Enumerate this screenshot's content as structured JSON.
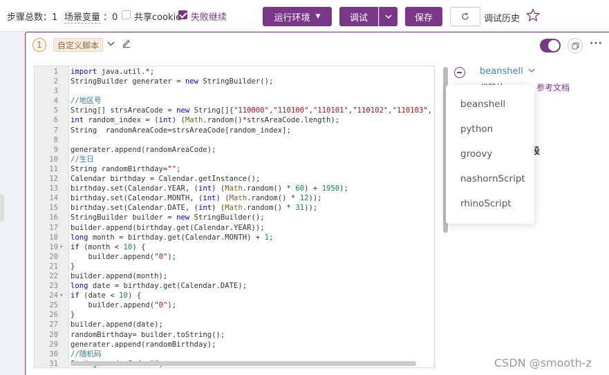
{
  "toolbar": {
    "step_count_label": "步骤总数：1",
    "scene_var_label": "场景变量",
    "scene_var_count": "：0",
    "share_cookie_label": "共享cookie",
    "fail_continue_label": "失败继续",
    "run_env_label": "运行环境",
    "debug_label": "调试",
    "save_label": "保存",
    "debug_history_label": "调试历史"
  },
  "step": {
    "number": "1",
    "tag": "自定义脚本"
  },
  "editor": {
    "lines": [
      {
        "n": "1",
        "text": "import java.util.*;"
      },
      {
        "n": "2",
        "text": "StringBuilder generater = new StringBuilder();"
      },
      {
        "n": "3",
        "text": ""
      },
      {
        "n": "4",
        "text": "//地区号"
      },
      {
        "n": "5",
        "text": "String[] strsAreaCode = new String[]{\"110000\",\"110100\",\"110101\",\"110102\",\"110103\","
      },
      {
        "n": "6",
        "text": "int random_index = (int) (Math.random()*strsAreaCode.length);"
      },
      {
        "n": "7",
        "text": "String  randomAreaCode=strsAreaCode[random_index];"
      },
      {
        "n": "8",
        "text": ""
      },
      {
        "n": "9",
        "text": "generater.append(randomAreaCode);"
      },
      {
        "n": "10",
        "text": "//生日"
      },
      {
        "n": "11",
        "text": "String randomBirthday=\"\";"
      },
      {
        "n": "12",
        "text": "Calendar birthday = Calendar.getInstance();"
      },
      {
        "n": "13",
        "text": "birthday.set(Calendar.YEAR, (int) (Math.random() * 60) + 1950);"
      },
      {
        "n": "14",
        "text": "birthday.set(Calendar.MONTH, (int) (Math.random() * 12));"
      },
      {
        "n": "15",
        "text": "birthday.set(Calendar.DATE, (int) (Math.random() * 31));"
      },
      {
        "n": "16",
        "text": "StringBuilder builder = new StringBuilder();"
      },
      {
        "n": "17",
        "text": "builder.append(birthday.get(Calendar.YEAR));"
      },
      {
        "n": "18",
        "text": "long month = birthday.get(Calendar.MONTH) + 1;"
      },
      {
        "n": "19",
        "text": "if (month < 10) {",
        "fold": true
      },
      {
        "n": "20",
        "text": "    builder.append(\"0\");"
      },
      {
        "n": "21",
        "text": "}"
      },
      {
        "n": "22",
        "text": "builder.append(month);"
      },
      {
        "n": "23",
        "text": "long date = birthday.get(Calendar.DATE);"
      },
      {
        "n": "24",
        "text": "if (date < 10) {",
        "fold": true
      },
      {
        "n": "25",
        "text": "    builder.append(\"0\");"
      },
      {
        "n": "26",
        "text": "}"
      },
      {
        "n": "27",
        "text": "builder.append(date);"
      },
      {
        "n": "28",
        "text": "randomBirthday= builder.toString();"
      },
      {
        "n": "29",
        "text": "generater.append(randomBirthday);"
      },
      {
        "n": "30",
        "text": "//随机码"
      },
      {
        "n": "31",
        "text": "String randomCode=\"\";"
      }
    ]
  },
  "right_panel": {
    "language": "beanshell",
    "ref_doc_label": "参考文档",
    "partial_text_1": "代码块 ⊕",
    "partial_text_2": "段"
  },
  "dropdown": {
    "options": [
      "beanshell",
      "python",
      "groovy",
      "nashornScript",
      "rhinoScript"
    ]
  },
  "watermark": "CSDN @smooth-z",
  "colors": {
    "accent": "#783887",
    "link": "#3a85d0"
  }
}
